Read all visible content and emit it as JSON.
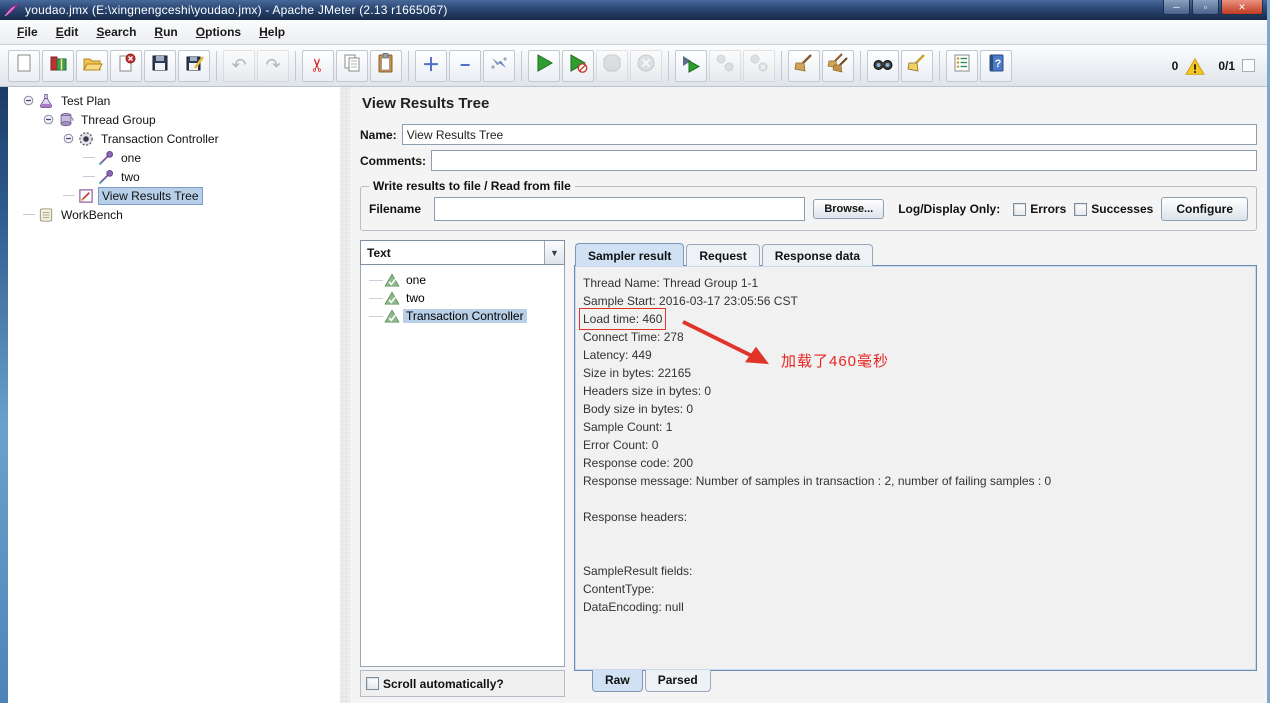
{
  "window": {
    "title": "youdao.jmx (E:\\xingnengceshi\\youdao.jmx) - Apache JMeter (2.13 r1665067)",
    "controls": {
      "minimize": "─",
      "maximize": "▫",
      "close": "✕"
    }
  },
  "menu": {
    "items": [
      {
        "name": "file",
        "label": "File"
      },
      {
        "name": "edit",
        "label": "Edit"
      },
      {
        "name": "search",
        "label": "Search"
      },
      {
        "name": "run",
        "label": "Run"
      },
      {
        "name": "options",
        "label": "Options"
      },
      {
        "name": "help",
        "label": "Help"
      }
    ]
  },
  "toolbar": {
    "groups": [
      [
        {
          "name": "new-file"
        },
        {
          "name": "templates"
        },
        {
          "name": "open-file"
        },
        {
          "name": "close-file"
        },
        {
          "name": "save"
        },
        {
          "name": "save-as"
        }
      ],
      [
        {
          "name": "undo",
          "disabled": true
        },
        {
          "name": "redo",
          "disabled": true
        }
      ],
      [
        {
          "name": "cut"
        },
        {
          "name": "copy"
        },
        {
          "name": "paste"
        }
      ],
      [
        {
          "name": "expand-all"
        },
        {
          "name": "collapse-all"
        },
        {
          "name": "toggle"
        }
      ],
      [
        {
          "name": "start"
        },
        {
          "name": "start-no-timers"
        },
        {
          "name": "stop",
          "disabled": true
        },
        {
          "name": "shutdown",
          "disabled": true
        }
      ],
      [
        {
          "name": "remote-start-all"
        },
        {
          "name": "remote-stop-all",
          "disabled": true
        },
        {
          "name": "remote-shutdown-all",
          "disabled": true
        }
      ],
      [
        {
          "name": "clear"
        },
        {
          "name": "clear-all"
        }
      ],
      [
        {
          "name": "search"
        },
        {
          "name": "search-reset"
        }
      ],
      [
        {
          "name": "function-helper"
        },
        {
          "name": "help"
        }
      ]
    ],
    "status": {
      "errors_count": "0",
      "threads_ratio": "0/1"
    }
  },
  "tree": {
    "nodes": [
      {
        "name": "test-plan",
        "label": "Test Plan",
        "level": 0,
        "icon": "test-plan",
        "handle": true
      },
      {
        "name": "thread-group",
        "label": "Thread Group",
        "level": 1,
        "icon": "thread-group",
        "handle": true
      },
      {
        "name": "transaction-controller",
        "label": "Transaction Controller",
        "level": 2,
        "icon": "transaction-controller",
        "handle": true
      },
      {
        "name": "sampler-one",
        "label": "one",
        "level": 3,
        "icon": "sampler"
      },
      {
        "name": "sampler-two",
        "label": "two",
        "level": 3,
        "icon": "sampler"
      },
      {
        "name": "view-results-tree",
        "label": "View Results Tree",
        "level": 2,
        "icon": "view-results-tree",
        "selected": true
      },
      {
        "name": "workbench",
        "label": "WorkBench",
        "level": 0,
        "icon": "workbench"
      }
    ]
  },
  "main": {
    "title": "View Results Tree",
    "name_label": "Name:",
    "name_value": "View Results Tree",
    "comments_label": "Comments:",
    "comments_value": "",
    "file_group": {
      "legend": "Write results to file / Read from file",
      "filename_label": "Filename",
      "filename_value": "",
      "browse_label": "Browse...",
      "log_display_label": "Log/Display Only:",
      "errors_label": "Errors",
      "successes_label": "Successes",
      "configure_label": "Configure"
    },
    "results_selector": {
      "value": "Text",
      "items": [
        {
          "label": "one"
        },
        {
          "label": "two"
        },
        {
          "label": "Transaction Controller",
          "selected": true
        }
      ],
      "scroll_label": "Scroll automatically?"
    },
    "tabs": [
      {
        "label": "Sampler result",
        "selected": true
      },
      {
        "label": "Request"
      },
      {
        "label": "Response data"
      }
    ],
    "sampler_result": {
      "lines": [
        "Thread Name: Thread Group 1-1",
        "Sample Start: 2016-03-17 23:05:56 CST",
        "Load time: 460",
        "Connect Time: 278",
        "Latency: 449",
        "Size in bytes: 22165",
        "Headers size in bytes: 0",
        "Body size in bytes: 0",
        "Sample Count: 1",
        "Error Count: 0",
        "Response code: 200",
        "Response message: Number of samples in transaction : 2, number of failing samples : 0",
        "",
        "Response headers:",
        "",
        "",
        "SampleResult fields:",
        "ContentType: ",
        "DataEncoding: null"
      ],
      "annotation": {
        "highlight_line_index": 2,
        "text": "加载了460毫秒",
        "color": "#e8251f"
      }
    },
    "bottom_tabs": [
      {
        "label": "Raw",
        "selected": true
      },
      {
        "label": "Parsed"
      }
    ]
  }
}
